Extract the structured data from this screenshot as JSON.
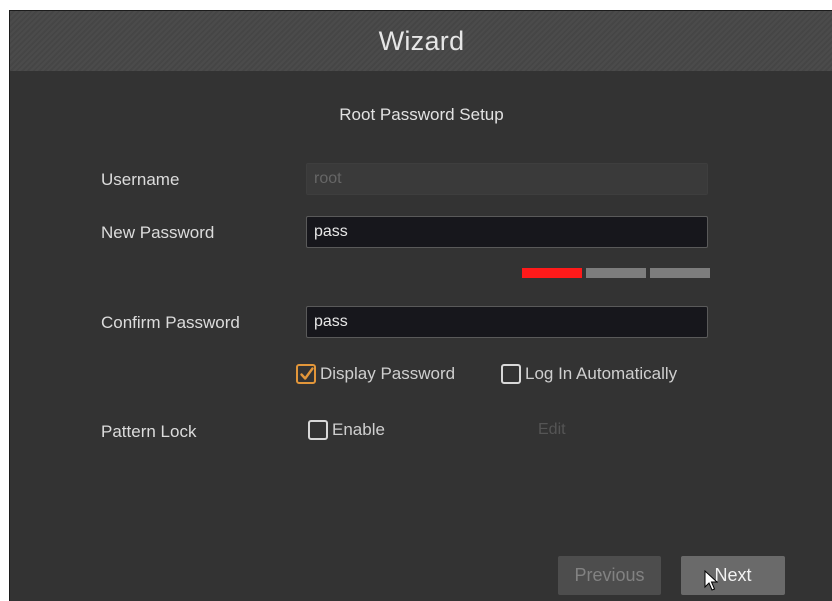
{
  "window": {
    "title": "Wizard",
    "subtitle": "Root Password Setup"
  },
  "form": {
    "username_label": "Username",
    "username_value": "root",
    "new_password_label": "New Password",
    "new_password_value": "pass",
    "password_strength": {
      "level": 1,
      "total": 3,
      "active_color": "#ff1a1a",
      "inactive_color": "#7d7d7d"
    },
    "confirm_password_label": "Confirm Password",
    "confirm_password_value": "pass",
    "display_password_label": "Display Password",
    "display_password_checked": true,
    "log_in_auto_label": "Log In Automatically",
    "log_in_auto_checked": false,
    "pattern_lock_label": "Pattern Lock",
    "pattern_enable_label": "Enable",
    "pattern_enable_checked": false,
    "edit_label": "Edit"
  },
  "buttons": {
    "previous_label": "Previous",
    "next_label": "Next"
  },
  "colors": {
    "background": "#333333",
    "titlebar": "#474747",
    "accent_check": "#e2963a"
  }
}
